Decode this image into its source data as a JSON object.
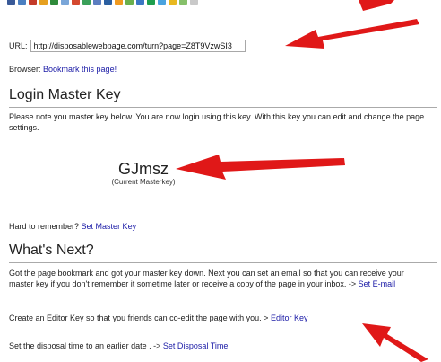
{
  "share_icons": [
    {
      "name": "share-icon-1",
      "color": "#3a5a98"
    },
    {
      "name": "share-icon-2",
      "color": "#4b7fc1"
    },
    {
      "name": "share-icon-3",
      "color": "#c33b2a"
    },
    {
      "name": "share-icon-4",
      "color": "#e6a020"
    },
    {
      "name": "share-icon-5",
      "color": "#2f8a3a"
    },
    {
      "name": "share-icon-6",
      "color": "#7aa6d8"
    },
    {
      "name": "share-icon-7",
      "color": "#d4482f"
    },
    {
      "name": "share-icon-8",
      "color": "#3aa05a"
    },
    {
      "name": "share-icon-9",
      "color": "#5c7ec0"
    },
    {
      "name": "share-icon-10",
      "color": "#2b5fa0"
    },
    {
      "name": "share-icon-11",
      "color": "#f09a20"
    },
    {
      "name": "share-icon-12",
      "color": "#6ab04c"
    },
    {
      "name": "share-icon-13",
      "color": "#3b77c4"
    },
    {
      "name": "share-icon-14",
      "color": "#1e9e4e"
    },
    {
      "name": "share-icon-15",
      "color": "#4aa3df"
    },
    {
      "name": "share-icon-16",
      "color": "#e8b820"
    },
    {
      "name": "share-icon-17",
      "color": "#86c06a"
    },
    {
      "name": "share-icon-18",
      "color": "#c9c9c9"
    }
  ],
  "url": {
    "label": "URL:",
    "value": "http://disposablewebpage.com/turn?page=Z8T9VzwSI3"
  },
  "browser": {
    "label": "Browser:",
    "link": "Bookmark this page!"
  },
  "login": {
    "title": "Login Master Key",
    "description": "Please note you master key below. You are now login using this key. With this key you can edit and change the page settings.",
    "master_key": "GJmsz",
    "master_key_caption": "(Current Masterkey)",
    "remember_text": "Hard to remember?",
    "remember_link": "Set Master Key"
  },
  "next": {
    "title": "What's Next?",
    "para1_text": "Got the page bookmark and got your master key down. Next you can set an email so that you can receive your master key if you don't remember it sometime later or receive a copy of the page in your inbox. ->",
    "para1_link": "Set E-mail",
    "para2_text": "Create an Editor Key so that you friends can co-edit the page with you. >",
    "para2_link": "Editor Key",
    "para3_text": "Set the disposal time to an earlier date . ->",
    "para3_link": "Set Disposal Time"
  },
  "colors": {
    "link": "#1a1aa6",
    "arrow": "#e01818",
    "rule": "#aaaaaa"
  }
}
